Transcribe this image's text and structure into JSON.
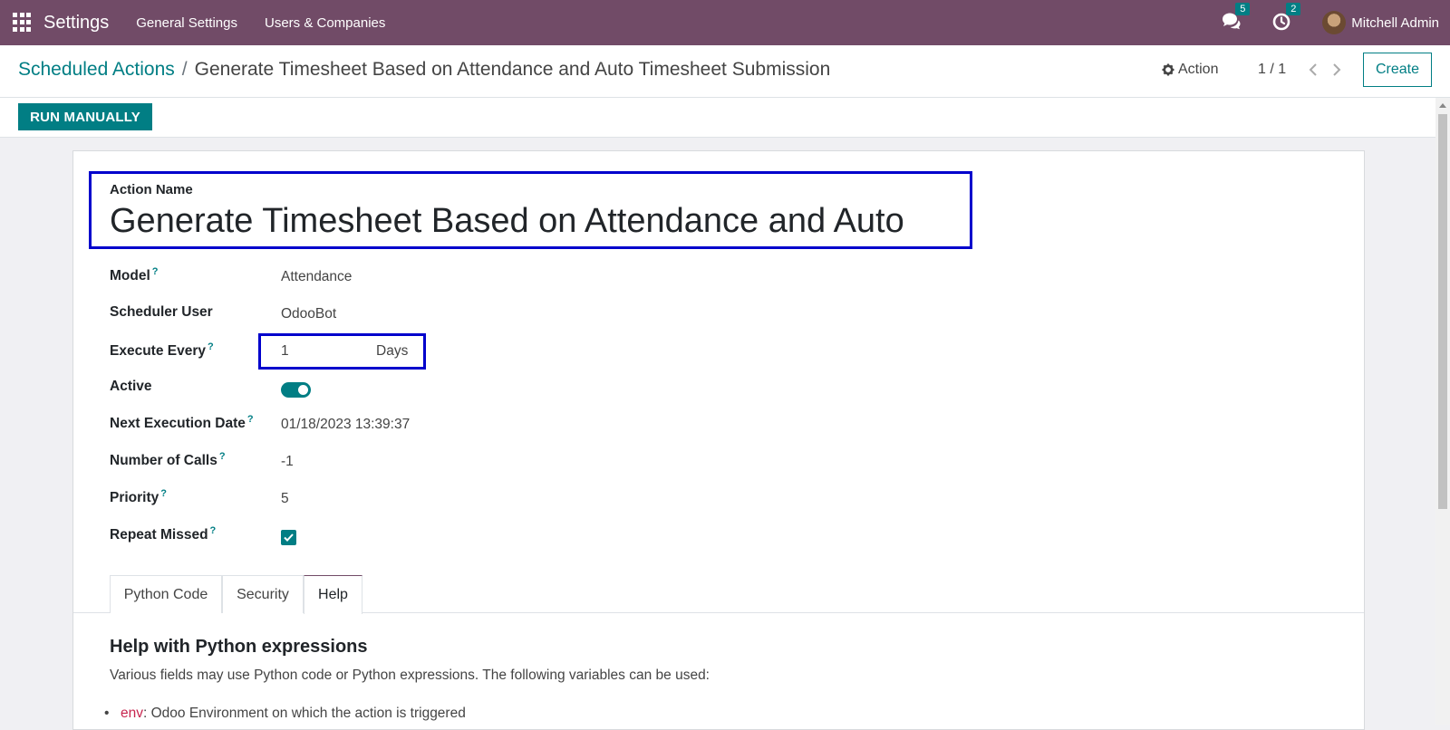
{
  "topbar": {
    "app_name": "Settings",
    "menu": [
      "General Settings",
      "Users & Companies"
    ],
    "messages_count": "5",
    "activities_count": "2",
    "user_name": "Mitchell Admin"
  },
  "control": {
    "breadcrumb_parent": "Scheduled Actions",
    "breadcrumb_separator": "/",
    "breadcrumb_current": "Generate Timesheet Based on Attendance and Auto Timesheet Submission",
    "action_label": "Action",
    "pager": "1 / 1",
    "create_label": "Create"
  },
  "status": {
    "run_manually_label": "RUN MANUALLY"
  },
  "form": {
    "action_name_label": "Action Name",
    "action_name_value": "Generate Timesheet Based on Attendance and Auto",
    "fields": {
      "model": {
        "label": "Model",
        "help": "?",
        "value": "Attendance"
      },
      "scheduler_user": {
        "label": "Scheduler User",
        "value": "OdooBot"
      },
      "execute_every": {
        "label": "Execute Every",
        "help": "?",
        "number": "1",
        "unit": "Days"
      },
      "active": {
        "label": "Active",
        "value": true
      },
      "next_execution": {
        "label": "Next Execution Date",
        "help": "?",
        "value": "01/18/2023 13:39:37"
      },
      "number_of_calls": {
        "label": "Number of Calls",
        "help": "?",
        "value": "-1"
      },
      "priority": {
        "label": "Priority",
        "help": "?",
        "value": "5"
      },
      "repeat_missed": {
        "label": "Repeat Missed",
        "help": "?",
        "value": true
      }
    },
    "tabs": [
      {
        "label": "Python Code",
        "active": false
      },
      {
        "label": "Security",
        "active": false
      },
      {
        "label": "Help",
        "active": true
      }
    ],
    "help": {
      "title": "Help with Python expressions",
      "intro": "Various fields may use Python code or Python expressions. The following variables can be used:",
      "items": [
        {
          "code": "env",
          "text": ": Odoo Environment on which the action is triggered"
        }
      ]
    }
  },
  "colors": {
    "brand": "#714b67",
    "accent": "#017e84",
    "highlight": "#0000cc"
  }
}
